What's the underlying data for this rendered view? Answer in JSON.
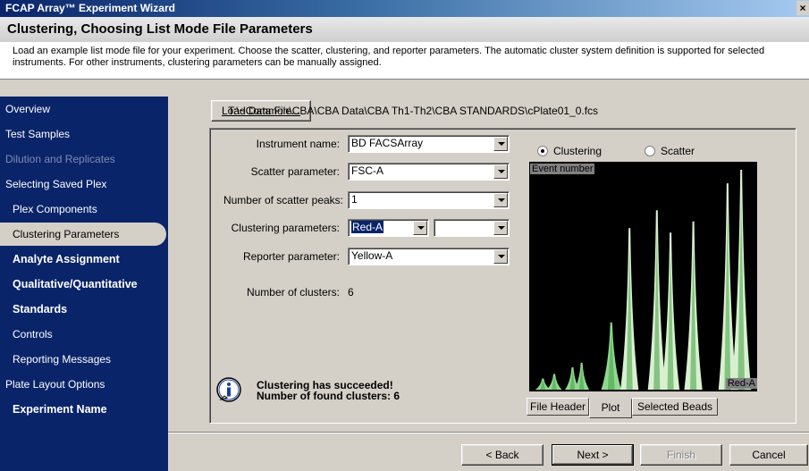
{
  "window": {
    "title": "FCAP Array™ Experiment Wizard",
    "close_label": "×"
  },
  "header": {
    "title": "Clustering, Choosing List Mode File Parameters",
    "description": "Load an example list mode file for your experiment. Choose the scatter, clustering, and reporter parameters. The automatic cluster system definition is supported for selected instruments. For other instruments, clustering parameters can be manually assigned."
  },
  "sidebar": {
    "items": [
      {
        "label": "Overview",
        "state": "normal"
      },
      {
        "label": "Test Samples",
        "state": "normal"
      },
      {
        "label": "Dilution and Replicates",
        "state": "disabled"
      },
      {
        "label": "Selecting Saved Plex",
        "state": "normal"
      },
      {
        "label": "Plex Components",
        "state": "sub"
      },
      {
        "label": "Clustering Parameters",
        "state": "active"
      },
      {
        "label": "Analyte Assignment",
        "state": "bold"
      },
      {
        "label": "Qualitative/Quantitative",
        "state": "bold"
      },
      {
        "label": "Standards",
        "state": "bold"
      },
      {
        "label": "Controls",
        "state": "sub"
      },
      {
        "label": "Reporting Messages",
        "state": "sub"
      },
      {
        "label": "Plate Layout Options",
        "state": "normal"
      },
      {
        "label": "Experiment Name",
        "state": "bold"
      }
    ]
  },
  "load": {
    "button_label": "Load Data File...",
    "file_path": "T:\\~Common\\CBA\\CBA Data\\CBA Th1-Th2\\CBA STANDARDS\\cPlate01_0.fcs"
  },
  "form": {
    "instrument_label": "Instrument name:",
    "instrument_value": "BD FACSArray",
    "scatter_label": "Scatter parameter:",
    "scatter_value": "FSC-A",
    "peaks_label": "Number of scatter peaks:",
    "peaks_value": "1",
    "clustering_label": "Clustering parameters:",
    "clustering_value": "Red-A",
    "clustering_value2": "",
    "reporter_label": "Reporter parameter:",
    "reporter_value": "Yellow-A",
    "clusters_label": "Number of clusters:",
    "clusters_value": "6"
  },
  "view": {
    "clustering_label": "Clustering",
    "scatter_label": "Scatter",
    "selected": "clustering"
  },
  "message": {
    "line1": "Clustering has succeeded!",
    "line2": "Number of found clusters: 6"
  },
  "tabs": [
    {
      "label": "File Header",
      "active": false
    },
    {
      "label": "Plot",
      "active": true
    },
    {
      "label": "Selected Beads",
      "active": false
    }
  ],
  "footer": {
    "back_label": "< Back",
    "next_label": "Next >",
    "finish_label": "Finish",
    "cancel_label": "Cancel"
  },
  "colors": {
    "sidebar_bg": "#0a246a",
    "plot_bg": "#000000",
    "peak_light": "#d8f0d0",
    "peak_mid": "#90d890",
    "peak_dark": "#3f9f3f"
  },
  "chart_data": {
    "type": "area",
    "ylabel": "Event number",
    "xlabel": "Red-A",
    "x_range": [
      0,
      1
    ],
    "y_range": [
      0,
      1
    ],
    "grid": false,
    "peaks": [
      {
        "center": 0.06,
        "height": 0.05,
        "width": 0.015
      },
      {
        "center": 0.11,
        "height": 0.07,
        "width": 0.015
      },
      {
        "center": 0.19,
        "height": 0.1,
        "width": 0.015
      },
      {
        "center": 0.23,
        "height": 0.12,
        "width": 0.015
      },
      {
        "center": 0.36,
        "height": 0.3,
        "width": 0.02
      },
      {
        "center": 0.44,
        "height": 0.72,
        "width": 0.018
      },
      {
        "center": 0.56,
        "height": 0.8,
        "width": 0.018
      },
      {
        "center": 0.62,
        "height": 0.7,
        "width": 0.018
      },
      {
        "center": 0.72,
        "height": 0.75,
        "width": 0.018
      },
      {
        "center": 0.87,
        "height": 0.92,
        "width": 0.018
      },
      {
        "center": 0.93,
        "height": 0.98,
        "width": 0.02
      }
    ]
  }
}
